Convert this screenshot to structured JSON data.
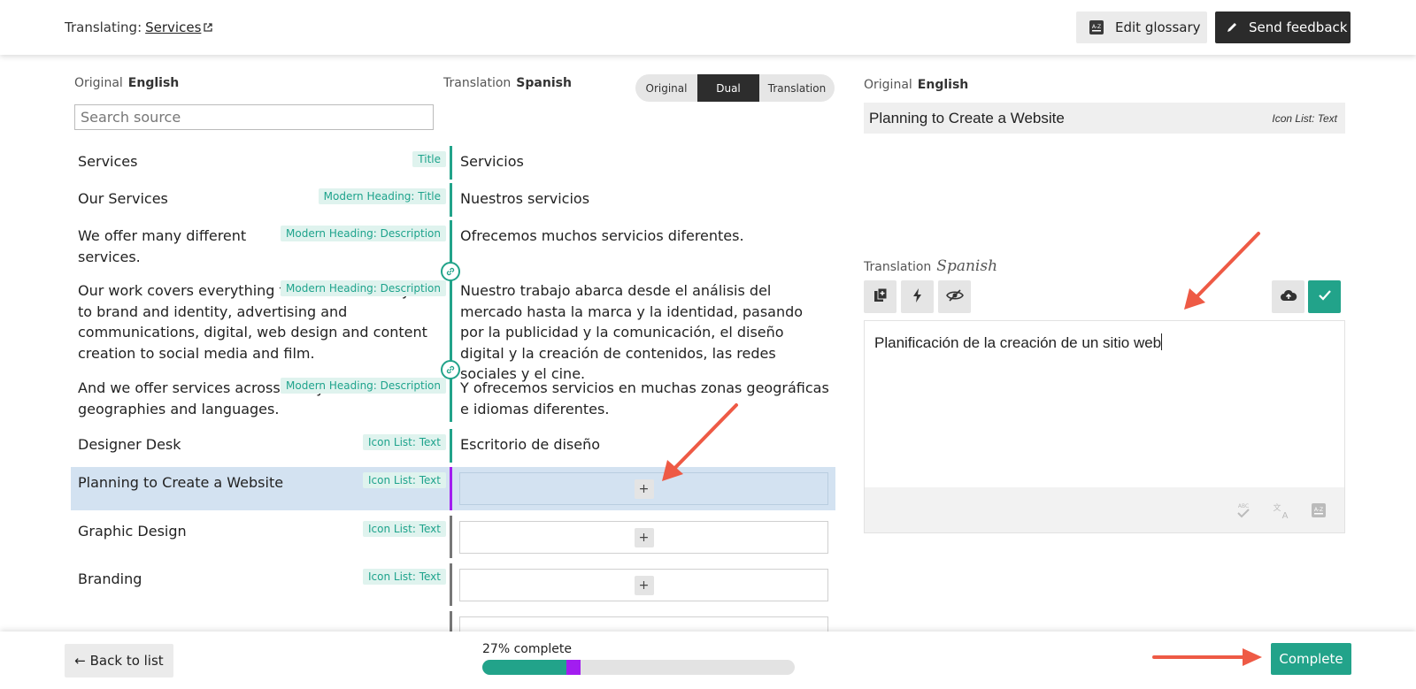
{
  "header": {
    "translating_label": "Translating:",
    "page_link": "Services",
    "glossary_button": "Edit glossary",
    "feedback_button": "Send feedback"
  },
  "source_column": {
    "label": "Original",
    "language": "English",
    "search_placeholder": "Search source"
  },
  "target_column": {
    "label": "Translation",
    "language": "Spanish"
  },
  "view_toggle": {
    "options": [
      "Original",
      "Dual",
      "Translation"
    ],
    "selected": "Dual"
  },
  "rows": [
    {
      "source": "Services",
      "tag": "Title",
      "translation": "Servicios"
    },
    {
      "source": "Our Services",
      "tag": "Modern Heading: Title",
      "translation": "Nuestros servicios"
    },
    {
      "source": "We offer many different services.",
      "tag": "Modern Heading: Description",
      "translation": "Ofrecemos muchos servicios diferentes."
    },
    {
      "source": "Our work covers everything from market analysis to brand and identity, advertising and communications, digital, web design and content creation to social media and film.",
      "tag": "Modern Heading: Description",
      "translation": "Nuestro trabajo abarca desde el análisis del mercado hasta la marca y la identidad, pasando por la publicidad y la comunicación, el diseño digital y la creación de contenidos, las redes sociales y el cine."
    },
    {
      "source": "And we offer services across many different geographies and languages.",
      "tag": "Modern Heading: Description",
      "translation": "Y ofrecemos servicios en muchas zonas geográficas e idiomas diferentes."
    },
    {
      "source": "Designer Desk",
      "tag": "Icon List: Text",
      "translation": "Escritorio de diseño"
    },
    {
      "source": "Planning to Create a Website",
      "tag": "Icon List: Text",
      "translation": "",
      "add": "+"
    },
    {
      "source": "Graphic Design",
      "tag": "Icon List: Text",
      "translation": "",
      "add": "+"
    },
    {
      "source": "Branding",
      "tag": "Icon List: Text",
      "translation": "",
      "add": "+"
    }
  ],
  "editor": {
    "original_label": "Original",
    "original_language": "English",
    "original_text": "Planning to Create a Website",
    "original_tag": "Icon List: Text",
    "translation_label": "Translation",
    "translation_language": "Spanish",
    "translation_text": "Planificación de la creación de un sitio web"
  },
  "footer": {
    "back_button": "← Back to list",
    "progress_label": "27% complete",
    "progress_percent": 27,
    "complete_button": "Complete"
  },
  "colors": {
    "accent": "#22a38a",
    "selected_marker": "#a21df0",
    "selected_row": "#d3e2f1",
    "arrow": "#ee5a45"
  }
}
